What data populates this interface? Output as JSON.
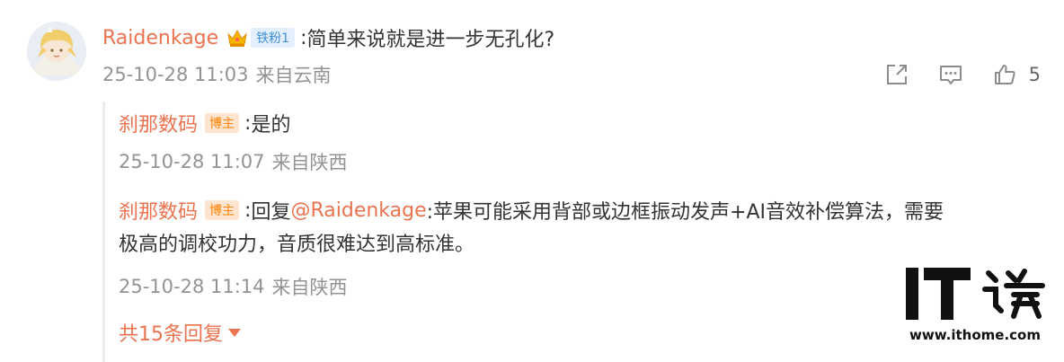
{
  "comment": {
    "author": "Raidenkage",
    "fan_badge": "铁粉1",
    "separator": ":",
    "text": "简单来说就是进一步无孔化?",
    "timestamp": "25-10-28 11:03",
    "location": "来自云南",
    "like_count": "5",
    "icons": [
      "share-icon",
      "comment-icon",
      "like-icon"
    ]
  },
  "replies": [
    {
      "author": "刹那数码",
      "badge": "博主",
      "separator": ":",
      "text": "是的",
      "timestamp": "25-10-28 11:07",
      "location": "来自陕西"
    },
    {
      "author": "刹那数码",
      "badge": "博主",
      "separator": ":",
      "reply_prefix": "回复 ",
      "mention": "@Raidenkage",
      "text_line1": ":苹果可能采用背部或边框振动发声+AI音效补偿算法，需要",
      "text_line2": "极高的调校功力，音质很难达到高标准。",
      "timestamp": "25-10-28 11:14",
      "location": "来自陕西"
    }
  ],
  "more_replies": "共15条回复",
  "watermark": {
    "logo": "IT之家",
    "url": "www.ithome.com"
  },
  "colors": {
    "author": "#eb7350",
    "meta": "#939393",
    "fan_badge_bg": "#e3effc",
    "blogger_badge_bg": "#ffe5d0",
    "blogger_badge_text": "#ff8200"
  }
}
